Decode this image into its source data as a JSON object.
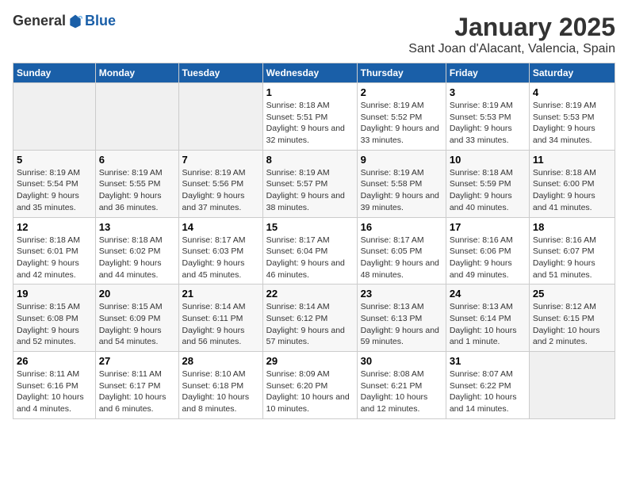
{
  "header": {
    "logo_general": "General",
    "logo_blue": "Blue",
    "title": "January 2025",
    "subtitle": "Sant Joan d'Alacant, Valencia, Spain"
  },
  "days_of_week": [
    "Sunday",
    "Monday",
    "Tuesday",
    "Wednesday",
    "Thursday",
    "Friday",
    "Saturday"
  ],
  "weeks": [
    [
      {
        "day": "",
        "info": ""
      },
      {
        "day": "",
        "info": ""
      },
      {
        "day": "",
        "info": ""
      },
      {
        "day": "1",
        "info": "Sunrise: 8:18 AM\nSunset: 5:51 PM\nDaylight: 9 hours and 32 minutes."
      },
      {
        "day": "2",
        "info": "Sunrise: 8:19 AM\nSunset: 5:52 PM\nDaylight: 9 hours and 33 minutes."
      },
      {
        "day": "3",
        "info": "Sunrise: 8:19 AM\nSunset: 5:53 PM\nDaylight: 9 hours and 33 minutes."
      },
      {
        "day": "4",
        "info": "Sunrise: 8:19 AM\nSunset: 5:53 PM\nDaylight: 9 hours and 34 minutes."
      }
    ],
    [
      {
        "day": "5",
        "info": "Sunrise: 8:19 AM\nSunset: 5:54 PM\nDaylight: 9 hours and 35 minutes."
      },
      {
        "day": "6",
        "info": "Sunrise: 8:19 AM\nSunset: 5:55 PM\nDaylight: 9 hours and 36 minutes."
      },
      {
        "day": "7",
        "info": "Sunrise: 8:19 AM\nSunset: 5:56 PM\nDaylight: 9 hours and 37 minutes."
      },
      {
        "day": "8",
        "info": "Sunrise: 8:19 AM\nSunset: 5:57 PM\nDaylight: 9 hours and 38 minutes."
      },
      {
        "day": "9",
        "info": "Sunrise: 8:19 AM\nSunset: 5:58 PM\nDaylight: 9 hours and 39 minutes."
      },
      {
        "day": "10",
        "info": "Sunrise: 8:18 AM\nSunset: 5:59 PM\nDaylight: 9 hours and 40 minutes."
      },
      {
        "day": "11",
        "info": "Sunrise: 8:18 AM\nSunset: 6:00 PM\nDaylight: 9 hours and 41 minutes."
      }
    ],
    [
      {
        "day": "12",
        "info": "Sunrise: 8:18 AM\nSunset: 6:01 PM\nDaylight: 9 hours and 42 minutes."
      },
      {
        "day": "13",
        "info": "Sunrise: 8:18 AM\nSunset: 6:02 PM\nDaylight: 9 hours and 44 minutes."
      },
      {
        "day": "14",
        "info": "Sunrise: 8:17 AM\nSunset: 6:03 PM\nDaylight: 9 hours and 45 minutes."
      },
      {
        "day": "15",
        "info": "Sunrise: 8:17 AM\nSunset: 6:04 PM\nDaylight: 9 hours and 46 minutes."
      },
      {
        "day": "16",
        "info": "Sunrise: 8:17 AM\nSunset: 6:05 PM\nDaylight: 9 hours and 48 minutes."
      },
      {
        "day": "17",
        "info": "Sunrise: 8:16 AM\nSunset: 6:06 PM\nDaylight: 9 hours and 49 minutes."
      },
      {
        "day": "18",
        "info": "Sunrise: 8:16 AM\nSunset: 6:07 PM\nDaylight: 9 hours and 51 minutes."
      }
    ],
    [
      {
        "day": "19",
        "info": "Sunrise: 8:15 AM\nSunset: 6:08 PM\nDaylight: 9 hours and 52 minutes."
      },
      {
        "day": "20",
        "info": "Sunrise: 8:15 AM\nSunset: 6:09 PM\nDaylight: 9 hours and 54 minutes."
      },
      {
        "day": "21",
        "info": "Sunrise: 8:14 AM\nSunset: 6:11 PM\nDaylight: 9 hours and 56 minutes."
      },
      {
        "day": "22",
        "info": "Sunrise: 8:14 AM\nSunset: 6:12 PM\nDaylight: 9 hours and 57 minutes."
      },
      {
        "day": "23",
        "info": "Sunrise: 8:13 AM\nSunset: 6:13 PM\nDaylight: 9 hours and 59 minutes."
      },
      {
        "day": "24",
        "info": "Sunrise: 8:13 AM\nSunset: 6:14 PM\nDaylight: 10 hours and 1 minute."
      },
      {
        "day": "25",
        "info": "Sunrise: 8:12 AM\nSunset: 6:15 PM\nDaylight: 10 hours and 2 minutes."
      }
    ],
    [
      {
        "day": "26",
        "info": "Sunrise: 8:11 AM\nSunset: 6:16 PM\nDaylight: 10 hours and 4 minutes."
      },
      {
        "day": "27",
        "info": "Sunrise: 8:11 AM\nSunset: 6:17 PM\nDaylight: 10 hours and 6 minutes."
      },
      {
        "day": "28",
        "info": "Sunrise: 8:10 AM\nSunset: 6:18 PM\nDaylight: 10 hours and 8 minutes."
      },
      {
        "day": "29",
        "info": "Sunrise: 8:09 AM\nSunset: 6:20 PM\nDaylight: 10 hours and 10 minutes."
      },
      {
        "day": "30",
        "info": "Sunrise: 8:08 AM\nSunset: 6:21 PM\nDaylight: 10 hours and 12 minutes."
      },
      {
        "day": "31",
        "info": "Sunrise: 8:07 AM\nSunset: 6:22 PM\nDaylight: 10 hours and 14 minutes."
      },
      {
        "day": "",
        "info": ""
      }
    ]
  ]
}
